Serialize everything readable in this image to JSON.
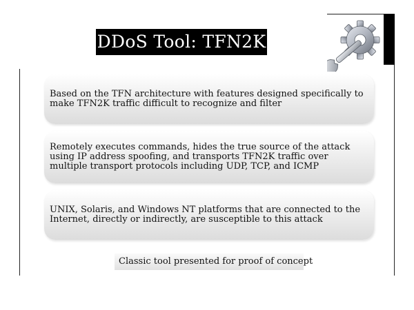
{
  "slide": {
    "title": "DDoS Tool: TFN2K",
    "icon": "gear-wrench-icon",
    "bullets": [
      "Based on the TFN architecture with features designed specifically to make TFN2K traffic difficult to recognize and filter",
      "Remotely executes commands, hides the true source of the attack using IP address spoofing, and transports TFN2K traffic over multiple transport protocols including UDP, TCP, and ICMP",
      "UNIX, Solaris, and Windows NT platforms that are connected to the Internet, directly or indirectly, are susceptible to this attack"
    ],
    "note": "Classic tool presented for proof of concept"
  }
}
